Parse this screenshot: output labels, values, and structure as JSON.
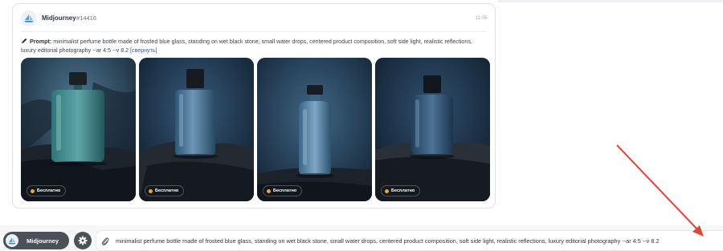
{
  "message": {
    "bot_name": "Midjourney",
    "job_id": "#14416",
    "time": "11:05",
    "prompt_label": "Prompt:",
    "prompt_text": "minimalist perfume bottle made of frosted blue glass, standing on wet black stone, small water drops, centered product composition, soft side light, realistic reflections, luxury editorial photography --ar 4:5 --v 8.2",
    "collapse_link": "[свернуть]"
  },
  "images": [
    {
      "badge": "Бесплатно"
    },
    {
      "badge": "Бесплатно"
    },
    {
      "badge": "Бесплатно"
    },
    {
      "badge": "Бесплатно"
    }
  ],
  "composer": {
    "model_label": "Midjourney",
    "input_value": "minimalist perfume bottle made of frosted blue glass, standing on wet black stone, small water drops, centered product composition, soft side light, realistic reflections, luxury editorial photography --ar 4:5 --v 8.2"
  },
  "icons": {
    "avatar": "sailboat-logo-icon",
    "prompt": "pencil-icon",
    "badge": "coin-icon",
    "settings": "gear-icon",
    "attach": "paperclip-icon"
  },
  "colors": {
    "annotation_arrow": "#e0473a",
    "pill_background": "#4c5057",
    "badge_coin": "#f0a430"
  }
}
